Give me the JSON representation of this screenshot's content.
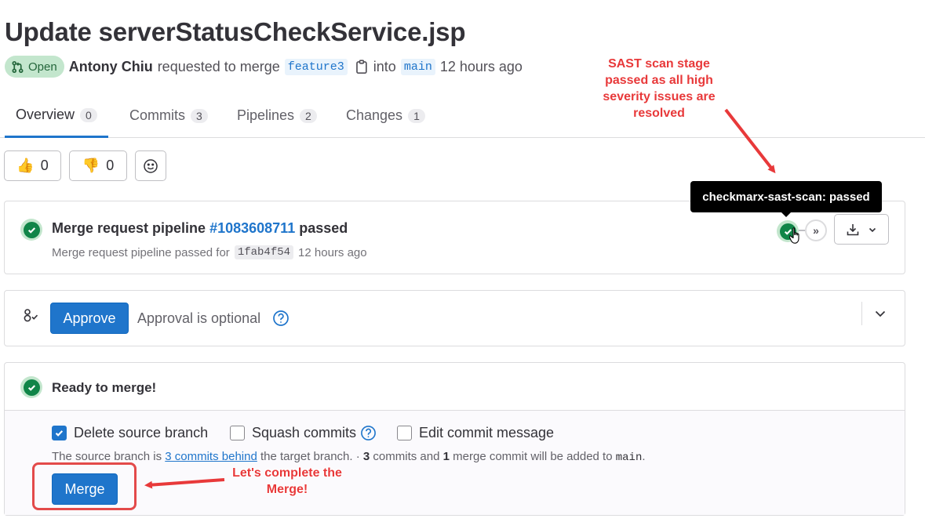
{
  "mr": {
    "title": "Update serverStatusCheckService.jsp",
    "status": "Open",
    "author": "Antony Chiu",
    "action_text": "requested to merge",
    "source_branch": "feature3",
    "into_text": "into",
    "target_branch": "main",
    "time_ago": "12 hours ago"
  },
  "tabs": [
    {
      "label": "Overview",
      "count": "0"
    },
    {
      "label": "Commits",
      "count": "3"
    },
    {
      "label": "Pipelines",
      "count": "2"
    },
    {
      "label": "Changes",
      "count": "1"
    }
  ],
  "reactions": {
    "thumbs_up_count": "0",
    "thumbs_down_count": "0"
  },
  "pipeline": {
    "title_prefix": "Merge request pipeline",
    "id": "#1083608711",
    "status_word": "passed",
    "subtitle": "Merge request pipeline passed for",
    "sha": "1fab4f54",
    "time_ago": "12 hours ago",
    "tooltip": "checkmarx-sast-scan: passed"
  },
  "approval": {
    "button": "Approve",
    "text": "Approval is optional"
  },
  "merge": {
    "status_title": "Ready to merge!",
    "delete_source": "Delete source branch",
    "delete_source_checked": true,
    "squash": "Squash commits",
    "squash_checked": false,
    "edit_message": "Edit commit message",
    "edit_message_checked": false,
    "behind_prefix": "The source branch is",
    "behind_link": "3 commits behind",
    "behind_mid": "the target branch. ·",
    "commit_count": "3",
    "commits_and": "commits and",
    "merge_commit_count": "1",
    "merge_commit_suffix": "merge commit will be added to",
    "target_branch": "main",
    "button": "Merge"
  },
  "annotations": {
    "sast_note": "SAST scan stage passed as all high severity issues are resolved",
    "merge_note": "Let's complete the Merge!",
    "color": "#e8393a"
  },
  "colors": {
    "primary": "#1f75cb",
    "success": "#108548",
    "success_bg": "#c3e6cd"
  }
}
